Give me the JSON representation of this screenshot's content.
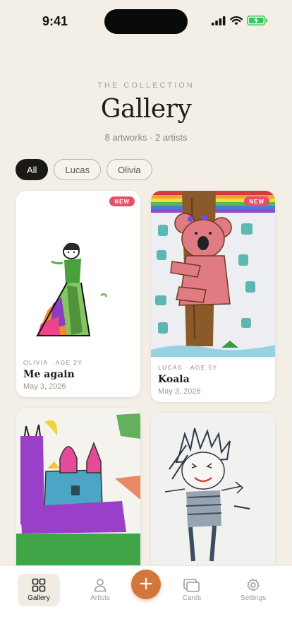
{
  "status_bar": {
    "time": "9:41"
  },
  "header": {
    "eyebrow": "THE COLLECTION",
    "title": "Gallery",
    "subtitle": "8 artworks · 2 artists"
  },
  "filters": {
    "chips": [
      "All",
      "Lucas",
      "Olivia"
    ],
    "selected": "All"
  },
  "artworks": [
    {
      "artist": "OLIVIA · AGE 2Y",
      "title": "Me again",
      "date": "May 3, 2026",
      "badge": "NEW"
    },
    {
      "artist": "LUCAS · AGE 5Y",
      "title": "Koala",
      "date": "May 3, 2026",
      "badge": "NEW"
    },
    {
      "artist": "",
      "title": "",
      "date": "",
      "badge": ""
    },
    {
      "artist": "",
      "title": "",
      "date": "",
      "badge": ""
    }
  ],
  "tabbar": {
    "items": [
      {
        "label": "Gallery",
        "icon": "grid-icon",
        "active": true
      },
      {
        "label": "Artists",
        "icon": "person-icon",
        "active": false
      },
      {
        "label": "+",
        "icon": "plus-icon",
        "active": false
      },
      {
        "label": "Cards",
        "icon": "cards-icon",
        "active": false
      },
      {
        "label": "Settings",
        "icon": "gear-icon",
        "active": false
      }
    ]
  },
  "colors": {
    "background": "#f3efe7",
    "badge": "#e4506a",
    "accent": "#d2763b",
    "chip_active": "#1b1917"
  }
}
